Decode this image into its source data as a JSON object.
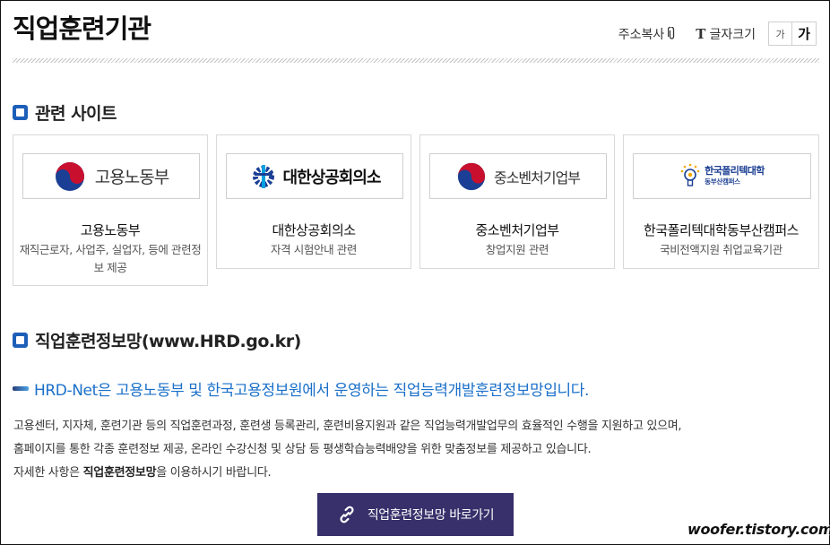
{
  "header": {
    "title": "직업훈련기관",
    "copy_address_label": "주소복사",
    "font_size_label": "글자크기",
    "font_small_label": "가",
    "font_large_label": "가"
  },
  "related": {
    "heading": "관련 사이트",
    "cards": [
      {
        "logo_text": "고용노동부",
        "name": "고용노동부",
        "desc": "재직근로자, 사업주, 실업자, 등에 관련정보 제공"
      },
      {
        "logo_text": "대한상공회의소",
        "name": "대한상공회의소",
        "desc": "자격 시험안내 관련"
      },
      {
        "logo_text": "중소벤처기업부",
        "name": "중소벤처기업부",
        "desc": "창업지원 관련"
      },
      {
        "logo_text": "한국폴리텍대학",
        "logo_subtext": "동부산캠퍼스",
        "name": "한국폴리텍대학동부산캠퍼스",
        "desc": "국비전액지원 취업교육기관"
      }
    ]
  },
  "hrd": {
    "heading": "직업훈련정보망(www.HRD.go.kr)",
    "lead": "HRD-Net은 고용노동부 및 한국고용정보원에서 운영하는 직업능력개발훈련정보망입니다.",
    "line1": "고용센터, 지자체, 훈련기관 등의 직업훈련과정, 훈련생 등록관리, 훈련비용지원과 같은 직업능력개발업무의 효율적인 수행을 지원하고 있으며,",
    "line2": "홈페이지를 통한 각종 훈련정보 제공, 온라인 수강신청 및 상담 등 평생학습능력배양을 위한 맞춤정보를 제공하고 있습니다.",
    "line3_pre": "자세한 사항은 ",
    "line3_bold": "직업훈련정보망",
    "line3_post": "을 이용하시기 바랍니다.",
    "button_label": "직업훈련정보망 바로가기"
  },
  "watermark": "woofer.tistory.com",
  "colors": {
    "accent_blue": "#1d5fb8",
    "lead_blue": "#1a6fc9",
    "button_purple": "#37306b"
  }
}
